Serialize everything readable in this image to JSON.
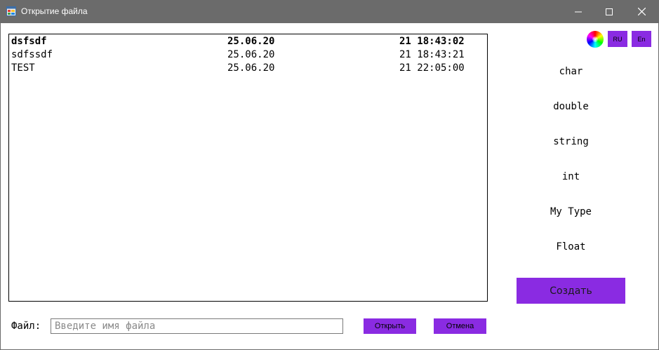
{
  "window": {
    "title": "Открытие файла",
    "icon": "app-window-icon",
    "controls": [
      "minimize-icon",
      "maximize-icon",
      "close-icon"
    ]
  },
  "file_list": {
    "rows": [
      {
        "name": "dsfsdf",
        "date": "25.06.20",
        "time": "21 18:43:02",
        "selected": true
      },
      {
        "name": "sdfssdf",
        "date": "25.06.20",
        "time": "21 18:43:21",
        "selected": false
      },
      {
        "name": "TEST",
        "date": "25.06.20",
        "time": "21 22:05:00",
        "selected": false
      }
    ]
  },
  "language": {
    "color_picker_icon": "color-wheel-icon",
    "ru_label": "RU",
    "en_label": "En"
  },
  "types": [
    "char",
    "double",
    "string",
    "int",
    "My Type",
    "Float"
  ],
  "create_button": "Создать",
  "file_field": {
    "label": "Файл:",
    "value": "",
    "placeholder": "Введите имя файла"
  },
  "buttons": {
    "open": "Открыть",
    "cancel": "Отмена"
  },
  "colors": {
    "accent": "#8a2be2",
    "titlebar": "#6b6b6b"
  }
}
